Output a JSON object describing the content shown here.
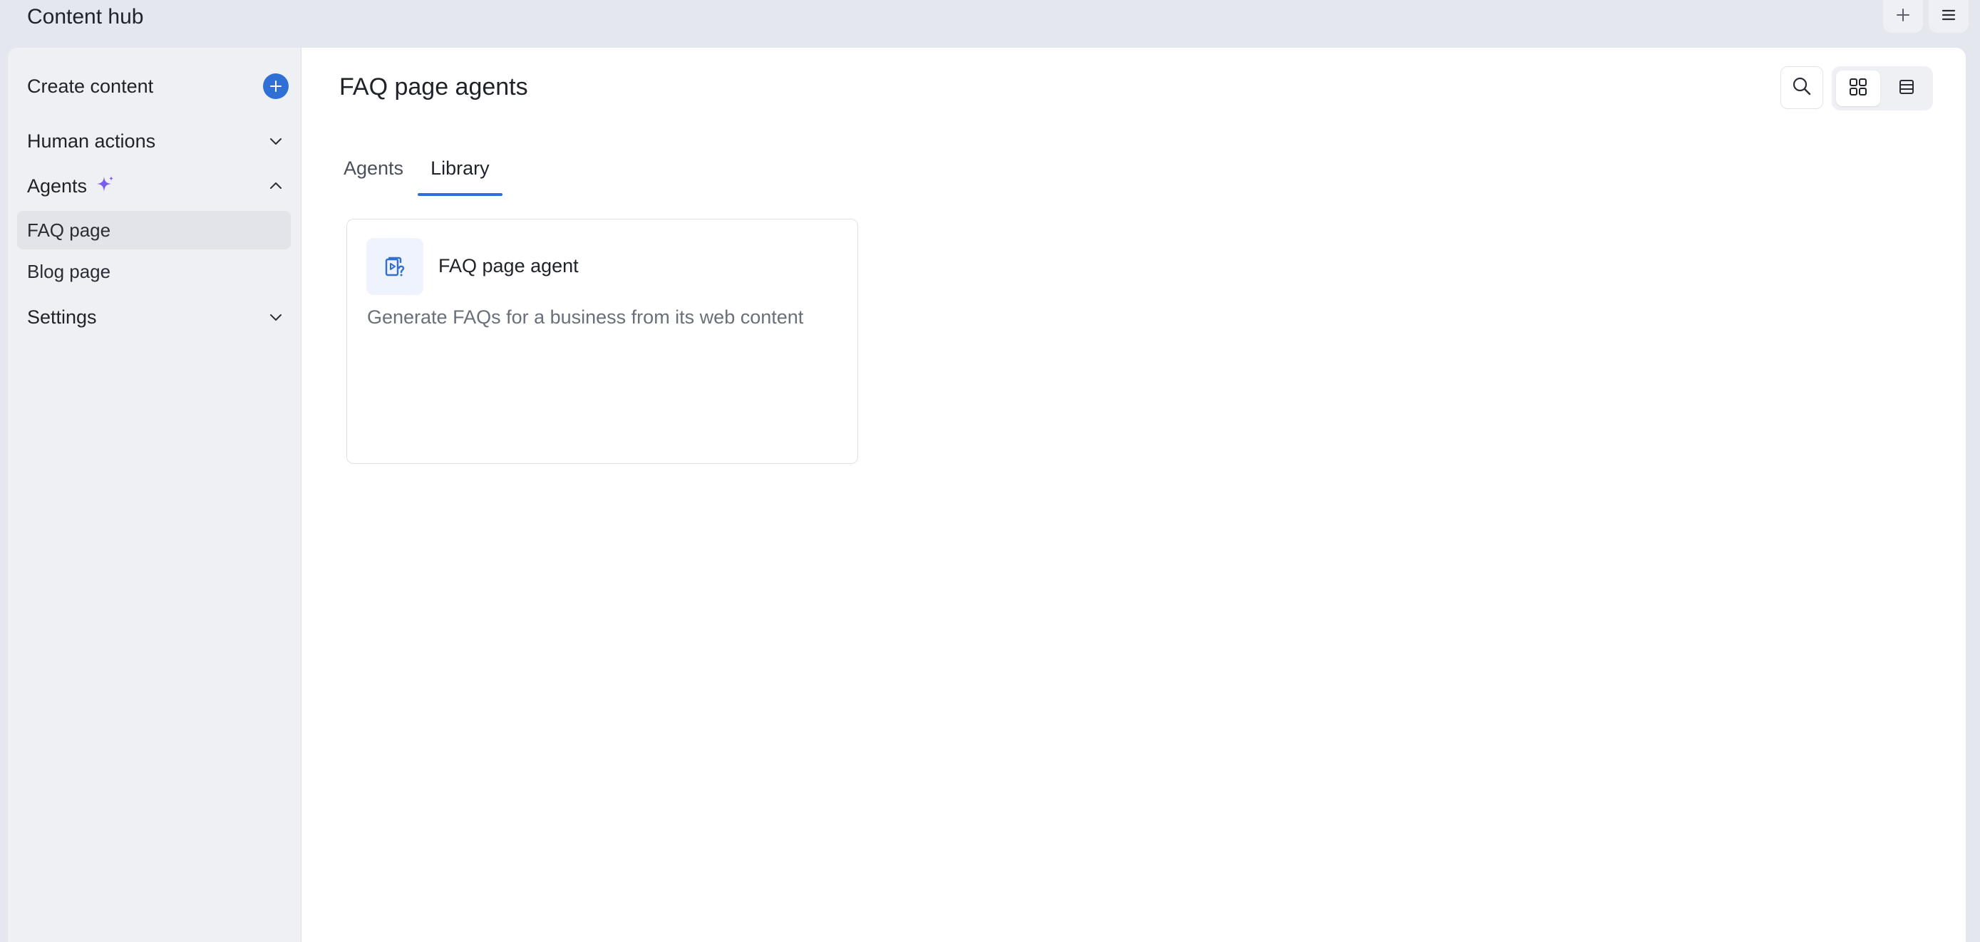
{
  "app": {
    "title": "Content hub"
  },
  "topbar": {
    "actions": [
      {
        "icon": "plus-icon"
      },
      {
        "icon": "hamburger-menu-icon"
      }
    ]
  },
  "sidebar": {
    "create": {
      "label": "Create content",
      "icon": "plus-circle-icon"
    },
    "sections": [
      {
        "label": "Human actions",
        "expanded": false,
        "icon": "chevron-down-icon"
      },
      {
        "label": "Agents",
        "expanded": true,
        "icon": "chevron-up-icon",
        "badge_icon": "sparkle-icon",
        "items": [
          {
            "label": "FAQ page",
            "active": true
          },
          {
            "label": "Blog page",
            "active": false
          }
        ]
      },
      {
        "label": "Settings",
        "expanded": false,
        "icon": "chevron-down-icon"
      }
    ]
  },
  "main": {
    "title": "FAQ page agents",
    "view_mode": "grid",
    "tabs": [
      {
        "label": "Agents",
        "active": false
      },
      {
        "label": "Library",
        "active": true
      }
    ],
    "cards": [
      {
        "title": "FAQ page agent",
        "description": "Generate FAQs for a business from its web content",
        "icon": "faq-document-icon"
      }
    ]
  },
  "colors": {
    "accent": "#2f6fd6",
    "sparkle": "#7b5cf0",
    "sidebar_bg": "#eff0f4",
    "page_bg": "#e4e7ee"
  }
}
